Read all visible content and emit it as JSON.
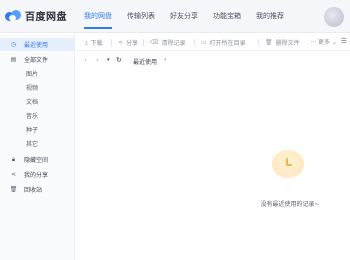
{
  "app": {
    "logo_text": "百度网盘"
  },
  "nav": {
    "items": [
      {
        "label": "我的网盘",
        "active": true
      },
      {
        "label": "传输列表",
        "active": false
      },
      {
        "label": "好友分享",
        "active": false
      },
      {
        "label": "功能宝箱",
        "active": false
      },
      {
        "label": "我的推荐",
        "active": false
      }
    ]
  },
  "sidebar": {
    "items": [
      {
        "label": "最近使用",
        "icon": "clock-icon",
        "active": true
      },
      {
        "label": "全部文件",
        "icon": "file-icon",
        "active": false
      },
      {
        "label": "隐藏空间",
        "icon": "lock-icon",
        "active": false
      },
      {
        "label": "我的分享",
        "icon": "share-icon",
        "active": false
      },
      {
        "label": "回收站",
        "icon": "trash-icon",
        "active": false
      }
    ],
    "subitems": [
      "图片",
      "视频",
      "文档",
      "音乐",
      "种子",
      "其它"
    ]
  },
  "toolbar": {
    "download": "下载",
    "share": "分享",
    "clear_records": "清除记录",
    "open_folder": "打开所在目录",
    "delete_file": "删除文件",
    "more": "更多"
  },
  "breadcrumb": {
    "current": "最近使用"
  },
  "empty_state": {
    "message": "没有最近使用的记录~"
  },
  "colors": {
    "accent": "#2f7cf6",
    "empty_icon": "#ffe6b3"
  }
}
